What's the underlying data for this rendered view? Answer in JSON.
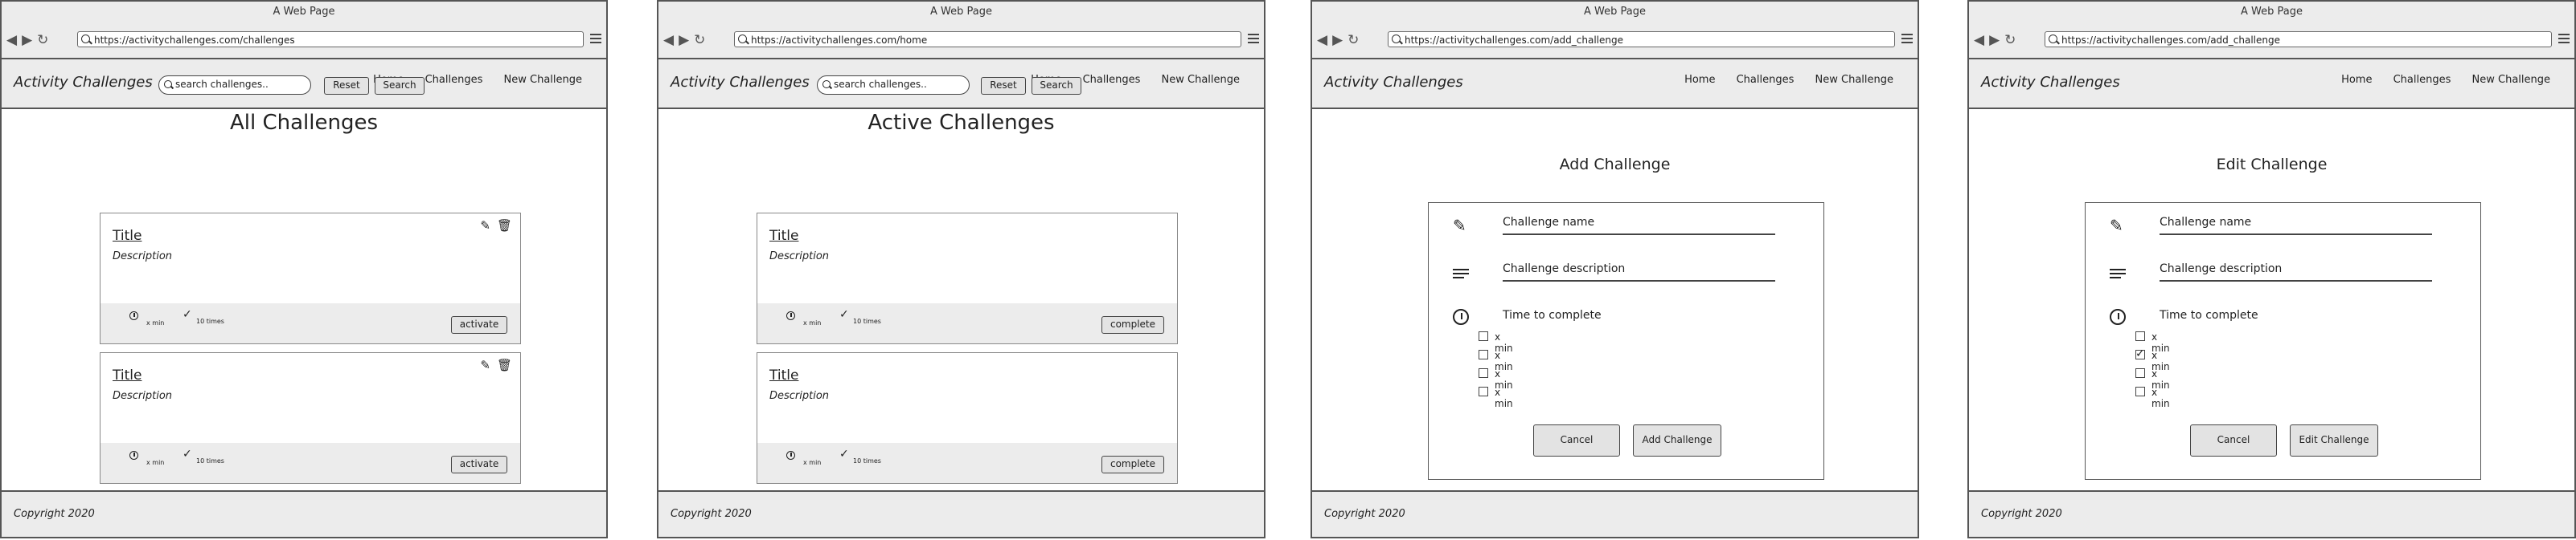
{
  "browser_title": "A Web Page",
  "screens": [
    {
      "id": "challenges",
      "url": "https://activitychallenges.com/challenges",
      "heading": "All Challenges",
      "card_action": "activate",
      "editable": true
    },
    {
      "id": "home",
      "url": "https://activitychallenges.com/home",
      "heading": "Active Challenges",
      "card_action": "complete",
      "editable": false
    },
    {
      "id": "add",
      "url": "https://activitychallenges.com/add_challenge",
      "heading": "Add Challenge",
      "submit": "Add Challenge"
    },
    {
      "id": "edit",
      "url": "https://activitychallenges.com/add_challenge",
      "heading": "Edit Challenge",
      "submit": "Edit Challenge"
    }
  ],
  "site": {
    "brand": "Activity Challenges",
    "nav": [
      "Home",
      "Challenges",
      "New Challenge"
    ],
    "footer": "Copyright 2020"
  },
  "search": {
    "placeholder": "search challenges..",
    "reset": "Reset",
    "search": "Search"
  },
  "card": {
    "title": "Title",
    "description": "Description",
    "duration": "x min",
    "count": "10 times"
  },
  "form": {
    "name_label": "Challenge name",
    "desc_label": "Challenge description",
    "time_label": "Time to complete",
    "options": [
      "x min",
      "x min",
      "x min",
      "x min"
    ],
    "edit_checked_index": 1,
    "cancel": "Cancel"
  },
  "icons": {
    "edit": "pencil-icon",
    "delete": "trash-icon",
    "time": "clock-icon",
    "count": "checkmark-icon",
    "search": "search-icon",
    "desc": "lines-icon"
  }
}
